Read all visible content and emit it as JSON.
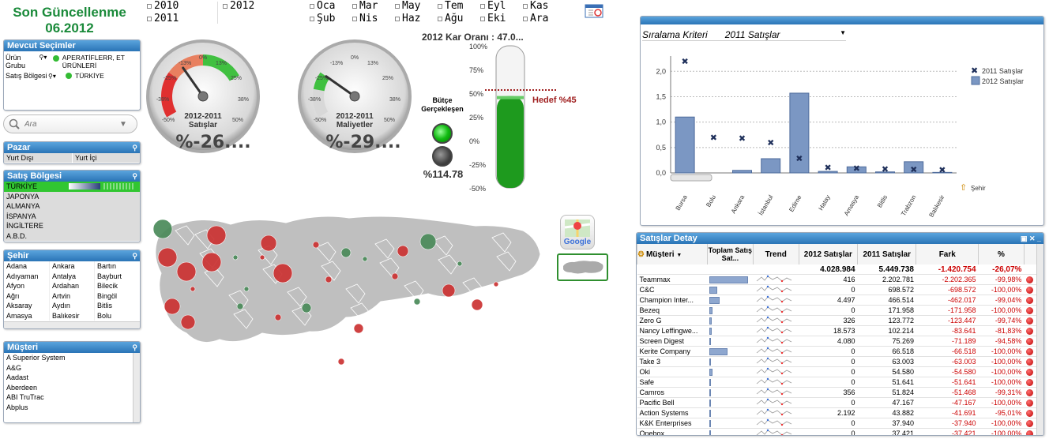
{
  "header": {
    "title_line1": "Son Güncellenme",
    "title_line2": "06.2012",
    "years": [
      "2010",
      "2012",
      "2011"
    ],
    "months": [
      "Oca",
      "Mar",
      "May",
      "Tem",
      "Eyl",
      "Kas",
      "Şub",
      "Nis",
      "Haz",
      "Ağu",
      "Eki",
      "Ara"
    ]
  },
  "mevcut": {
    "title": "Mevcut Seçimler",
    "rows": [
      {
        "label": "Ürün Grubu",
        "value": "APERATİFLERR, ET ÜRÜNLERİ"
      },
      {
        "label": "Satış Bölgesi",
        "value": "TÜRKİYE"
      }
    ]
  },
  "search": {
    "placeholder": "Ara"
  },
  "pazar": {
    "title": "Pazar",
    "items": [
      "Yurt Dışı",
      "Yurt İçi"
    ]
  },
  "satis_bolgesi": {
    "title": "Satış Bölgesi",
    "items": [
      "TÜRKİYE",
      "JAPONYA",
      "ALMANYA",
      "İSPANYA",
      "İNGİLTERE",
      "A.B.D."
    ]
  },
  "sehir": {
    "title": "Şehir",
    "cols": [
      [
        "Adana",
        "Adıyaman",
        "Afyon",
        "Ağrı",
        "Aksaray",
        "Amasya"
      ],
      [
        "Ankara",
        "Antalya",
        "Ardahan",
        "Artvin",
        "Aydın",
        "Balıkesir"
      ],
      [
        "Bartın",
        "Bayburt",
        "Bilecik",
        "Bingöl",
        "Bitlis",
        "Bolu"
      ]
    ]
  },
  "musteri": {
    "title": "Müşteri",
    "items": [
      "A Superior System",
      "A&G",
      "Aadast",
      "Aberdeen",
      "ABI TruTrac",
      "Abplus"
    ]
  },
  "gauges": {
    "g1": {
      "label1": "2012-2011",
      "label2": "Satışlar",
      "value": "%-26....",
      "ticks": [
        "0%",
        "-13%",
        "13%",
        "-25%",
        "25%",
        "-38%",
        "38%",
        "-50%",
        "50%"
      ]
    },
    "g2": {
      "label1": "2012-2011",
      "label2": "Maliyetler",
      "value": "%-29....",
      "ticks": [
        "0%",
        "-13%",
        "13%",
        "-25%",
        "25%",
        "-38%",
        "38%",
        "-50%",
        "50%"
      ]
    }
  },
  "budget": {
    "label": "Bütçe Gerçekleşen",
    "value": "%114.78"
  },
  "thermo": {
    "title": "2012 Kar Oranı : 47.0...",
    "ticks": [
      "100%",
      "75%",
      "50%",
      "25%",
      "0%",
      "-25%",
      "-50%"
    ],
    "fill_value": 47,
    "target_label": "Hedef %45"
  },
  "chart": {
    "dropdown_label": "Sıralama Kriteri",
    "dropdown_value": "2011 Satışlar",
    "legend": [
      "2011 Satışlar",
      "2012 Satışlar"
    ],
    "extra_label": "Şehir",
    "colors": {
      "bar": "#7b97c3",
      "marker": "#1e2f5a"
    }
  },
  "chart_data": {
    "type": "bar",
    "categories": [
      "Bursa",
      "Bolu",
      "Ankara",
      "İstanbul",
      "Edirne",
      "Hatay",
      "Amasya",
      "Bitlis",
      "Trabzon",
      "Balıkesir"
    ],
    "series": [
      {
        "name": "2012 Satışlar",
        "values": [
          1.1,
          0.0,
          0.05,
          0.28,
          1.57,
          0.03,
          0.12,
          0.02,
          0.22,
          0.01
        ]
      },
      {
        "name": "2011 Satışlar",
        "values": [
          2.2,
          0.7,
          0.68,
          0.6,
          0.29,
          0.11,
          0.09,
          0.08,
          0.07,
          0.06
        ]
      }
    ],
    "y_ticks": [
      "0,0",
      "0,5",
      "1,0",
      "1,5",
      "2,0"
    ],
    "ylim": [
      0,
      2.3
    ]
  },
  "detay": {
    "title": "Satışlar Detay",
    "headers": [
      "Müşteri",
      "Toplam Satış Sat...",
      "Trend",
      "2012 Satışlar",
      "2011 Satışlar",
      "Fark",
      "%"
    ],
    "totals": [
      "4.028.984",
      "5.449.738",
      "-1.420.754",
      "-26,07%"
    ],
    "rows": [
      {
        "name": "Teammax",
        "bar": 0.95,
        "s2012": "416",
        "s2011": "2.202.781",
        "fark": "-2.202.365",
        "pct": "-99,98%"
      },
      {
        "name": "C&C",
        "bar": 0.2,
        "s2012": "0",
        "s2011": "698.572",
        "fark": "-698.572",
        "pct": "-100,00%"
      },
      {
        "name": "Champion Inter...",
        "bar": 0.25,
        "s2012": "4.497",
        "s2011": "466.514",
        "fark": "-462.017",
        "pct": "-99,04%"
      },
      {
        "name": "Bezeq",
        "bar": 0.08,
        "s2012": "0",
        "s2011": "171.958",
        "fark": "-171.958",
        "pct": "-100,00%"
      },
      {
        "name": "Zero G",
        "bar": 0.06,
        "s2012": "326",
        "s2011": "123.772",
        "fark": "-123.447",
        "pct": "-99,74%"
      },
      {
        "name": "Nancy Leffingwe...",
        "bar": 0.05,
        "s2012": "18.573",
        "s2011": "102.214",
        "fark": "-83.641",
        "pct": "-81,83%"
      },
      {
        "name": "Screen Digest",
        "bar": 0.04,
        "s2012": "4.080",
        "s2011": "75.269",
        "fark": "-71.189",
        "pct": "-94,58%"
      },
      {
        "name": "Kerite Company",
        "bar": 0.45,
        "s2012": "0",
        "s2011": "66.518",
        "fark": "-66.518",
        "pct": "-100,00%"
      },
      {
        "name": "Take 3",
        "bar": 0.04,
        "s2012": "0",
        "s2011": "63.003",
        "fark": "-63.003",
        "pct": "-100,00%"
      },
      {
        "name": "Oki",
        "bar": 0.07,
        "s2012": "0",
        "s2011": "54.580",
        "fark": "-54.580",
        "pct": "-100,00%"
      },
      {
        "name": "Safe",
        "bar": 0.03,
        "s2012": "0",
        "s2011": "51.641",
        "fark": "-51.641",
        "pct": "-100,00%"
      },
      {
        "name": "Camros",
        "bar": 0.03,
        "s2012": "356",
        "s2011": "51.824",
        "fark": "-51.468",
        "pct": "-99,31%"
      },
      {
        "name": "Pacific Bell",
        "bar": 0.03,
        "s2012": "0",
        "s2011": "47.167",
        "fark": "-47.167",
        "pct": "-100,00%"
      },
      {
        "name": "Action Systems",
        "bar": 0.03,
        "s2012": "2.192",
        "s2011": "43.882",
        "fark": "-41.691",
        "pct": "-95,01%"
      },
      {
        "name": "K&K Enterprises",
        "bar": 0.02,
        "s2012": "0",
        "s2011": "37.940",
        "fark": "-37.940",
        "pct": "-100,00%"
      },
      {
        "name": "Onebox",
        "bar": 0.02,
        "s2012": "0",
        "s2011": "37.421",
        "fark": "-37.421",
        "pct": "-100,00%"
      }
    ]
  }
}
